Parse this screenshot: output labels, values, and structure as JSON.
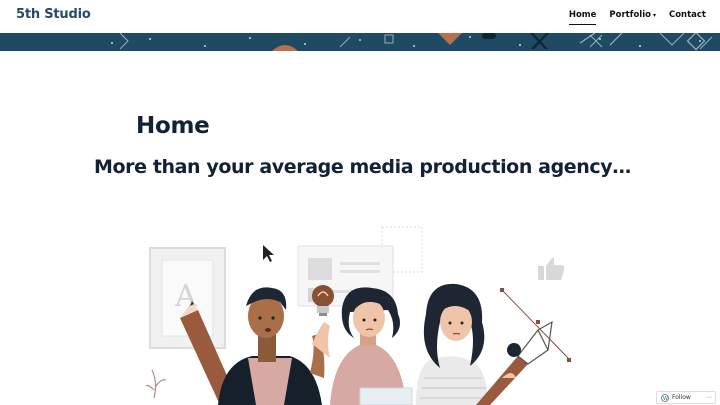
{
  "header": {
    "site_title": "5th Studio",
    "nav": [
      {
        "label": "Home",
        "active": true
      },
      {
        "label": "Portfolio",
        "dropdown": true
      },
      {
        "label": "Contact"
      }
    ]
  },
  "main": {
    "heading": "Home",
    "tagline": "More than your average media production agency…"
  },
  "follow_widget": {
    "label": "Follow",
    "more": "⋯"
  },
  "colors": {
    "brand": "#2a4a68",
    "banner": "#1f4a63",
    "accent_brown": "#9a5a3e"
  },
  "icons": [
    "chevron-down-icon",
    "cursor-arrow-icon",
    "lightbulb-icon",
    "thumbs-up-icon",
    "pencil-icon",
    "pen-tool-icon",
    "wordpress-icon"
  ]
}
